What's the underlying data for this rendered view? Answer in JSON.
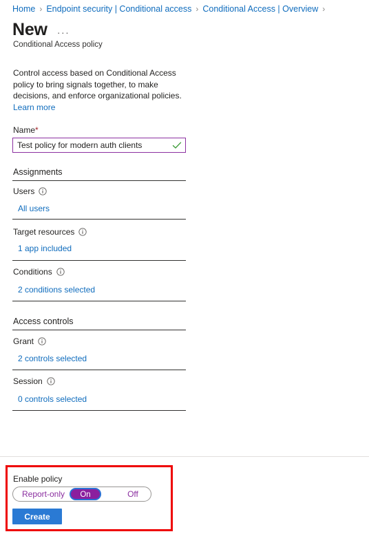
{
  "breadcrumb": {
    "separator": "›",
    "items": [
      {
        "label": "Home"
      },
      {
        "label": "Endpoint security | Conditional access"
      },
      {
        "label": "Conditional Access | Overview"
      }
    ],
    "trailing_separator": "›"
  },
  "header": {
    "title": "New",
    "overflow_label": "···",
    "subtitle": "Conditional Access policy"
  },
  "description": {
    "text": "Control access based on Conditional Access policy to bring signals together, to make decisions, and enforce organizational policies.",
    "learn_more": "Learn more"
  },
  "name_field": {
    "label": "Name",
    "required_marker": "*",
    "value": "Test policy for modern auth clients",
    "placeholder": "",
    "valid_icon": "checkmark-icon",
    "border_color": "#8b2fa0",
    "check_color": "#3a9b35"
  },
  "sections": [
    {
      "heading": "Assignments",
      "rows": [
        {
          "label": "Users",
          "info_icon": "info-icon",
          "value": "All users"
        },
        {
          "label": "Target resources",
          "info_icon": "info-icon",
          "value": "1 app included"
        },
        {
          "label": "Conditions",
          "info_icon": "info-icon",
          "value": "2 conditions selected"
        }
      ]
    },
    {
      "heading": "Access controls",
      "rows": [
        {
          "label": "Grant",
          "info_icon": "info-icon",
          "value": "2 controls selected"
        },
        {
          "label": "Session",
          "info_icon": "info-icon",
          "value": "0 controls selected"
        }
      ]
    }
  ],
  "footer": {
    "enable_policy_label": "Enable policy",
    "toggle": {
      "options": [
        {
          "label": "Report-only",
          "selected": false
        },
        {
          "label": "On",
          "selected": true
        },
        {
          "label": "Off",
          "selected": false
        }
      ],
      "selected_value": "On",
      "selected_color": "#8b1f9e",
      "focus_ring_color": "#2a6fd4",
      "text_color": "#8b2fa0"
    },
    "create_button": "Create",
    "create_button_color": "#2a7ad4",
    "highlight_color": "#ee0000"
  }
}
